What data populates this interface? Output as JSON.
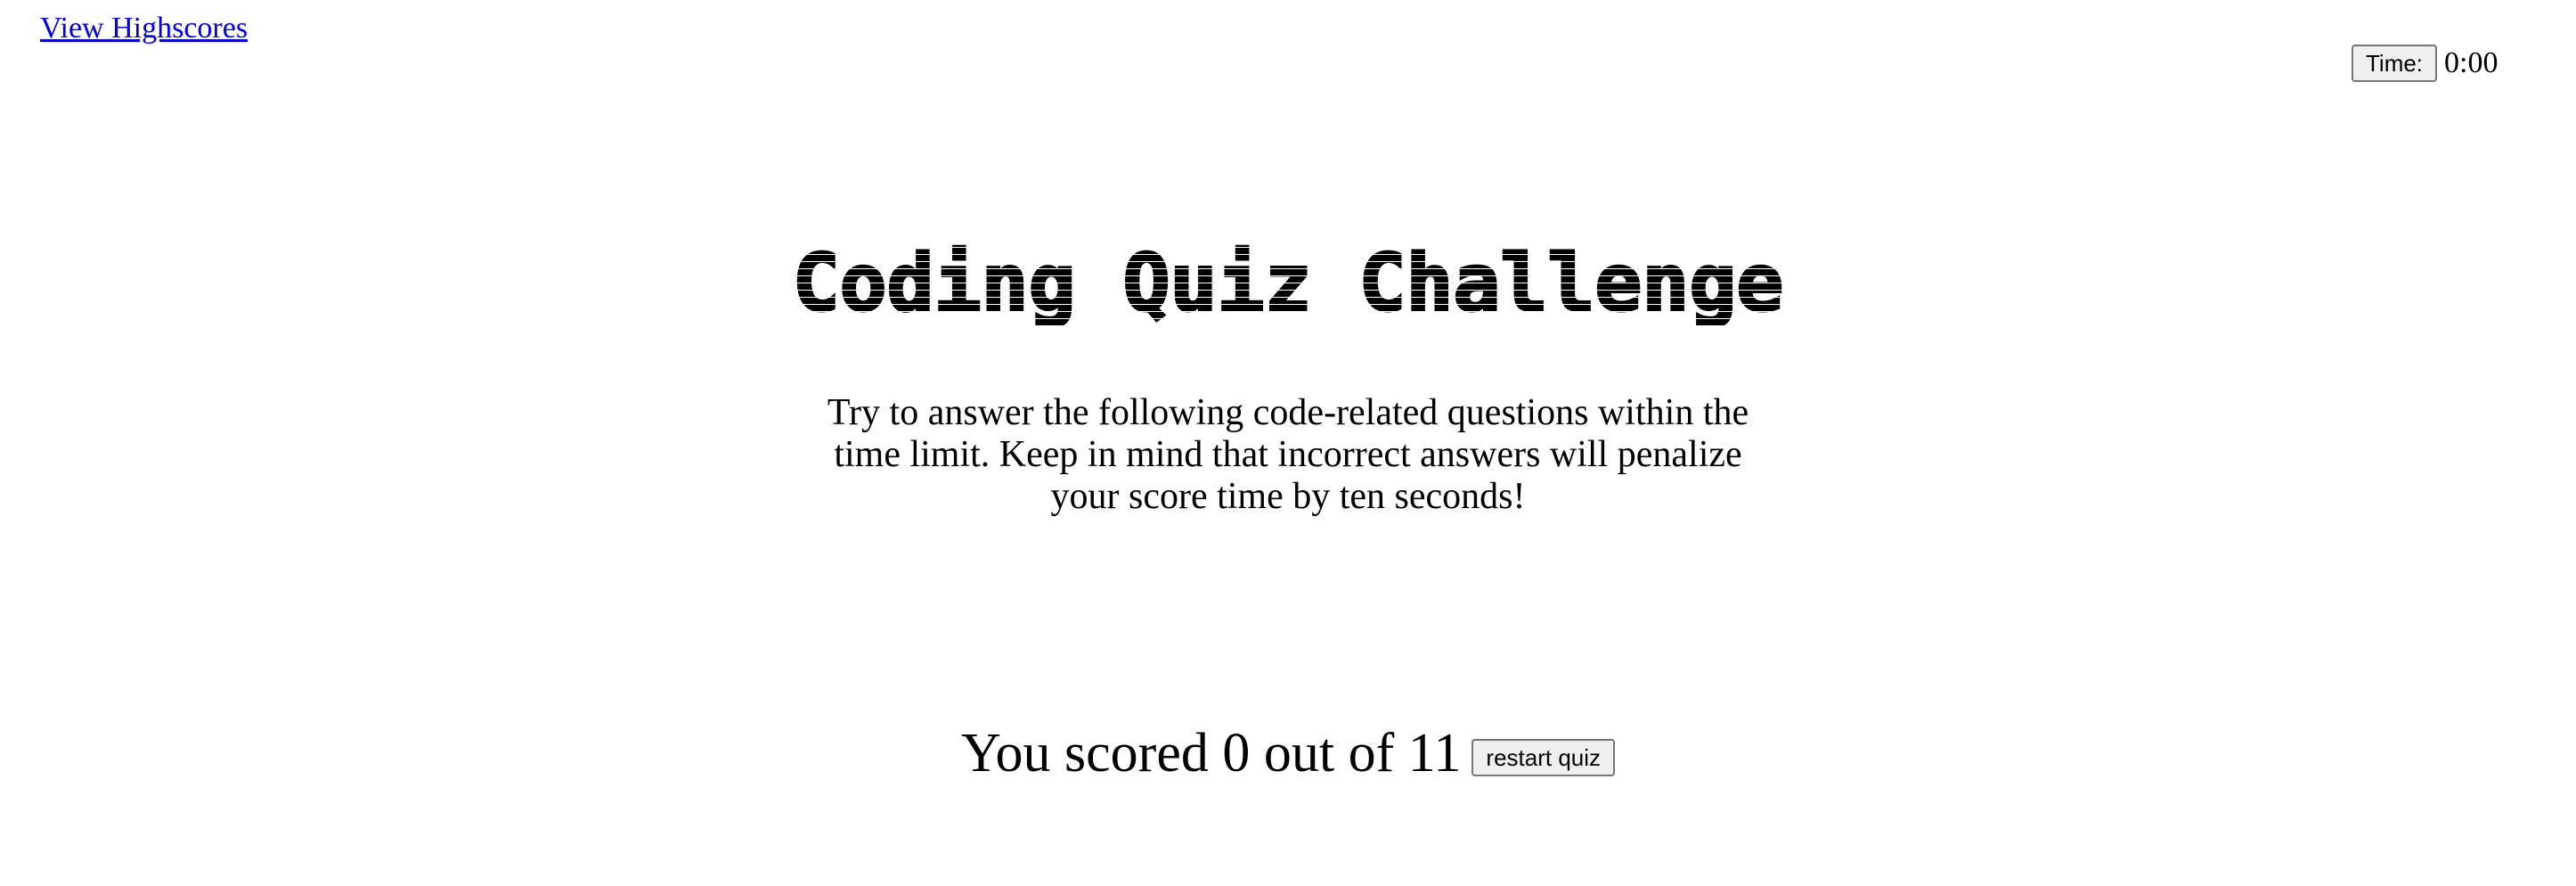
{
  "header": {
    "highscores_link": "View Highscores",
    "timer_button": "Time:",
    "timer_value": "0:00"
  },
  "main": {
    "title": "Coding Quiz Challenge",
    "intro": "Try to answer the following code-related questions within the time limit. Keep in mind that incorrect answers will penalize your score time by ten seconds!"
  },
  "result": {
    "score_text": "You scored 0 out of 11",
    "restart_button": "restart quiz"
  },
  "colors": {
    "link": "#0000ee",
    "text": "#000000",
    "background": "#ffffff"
  }
}
